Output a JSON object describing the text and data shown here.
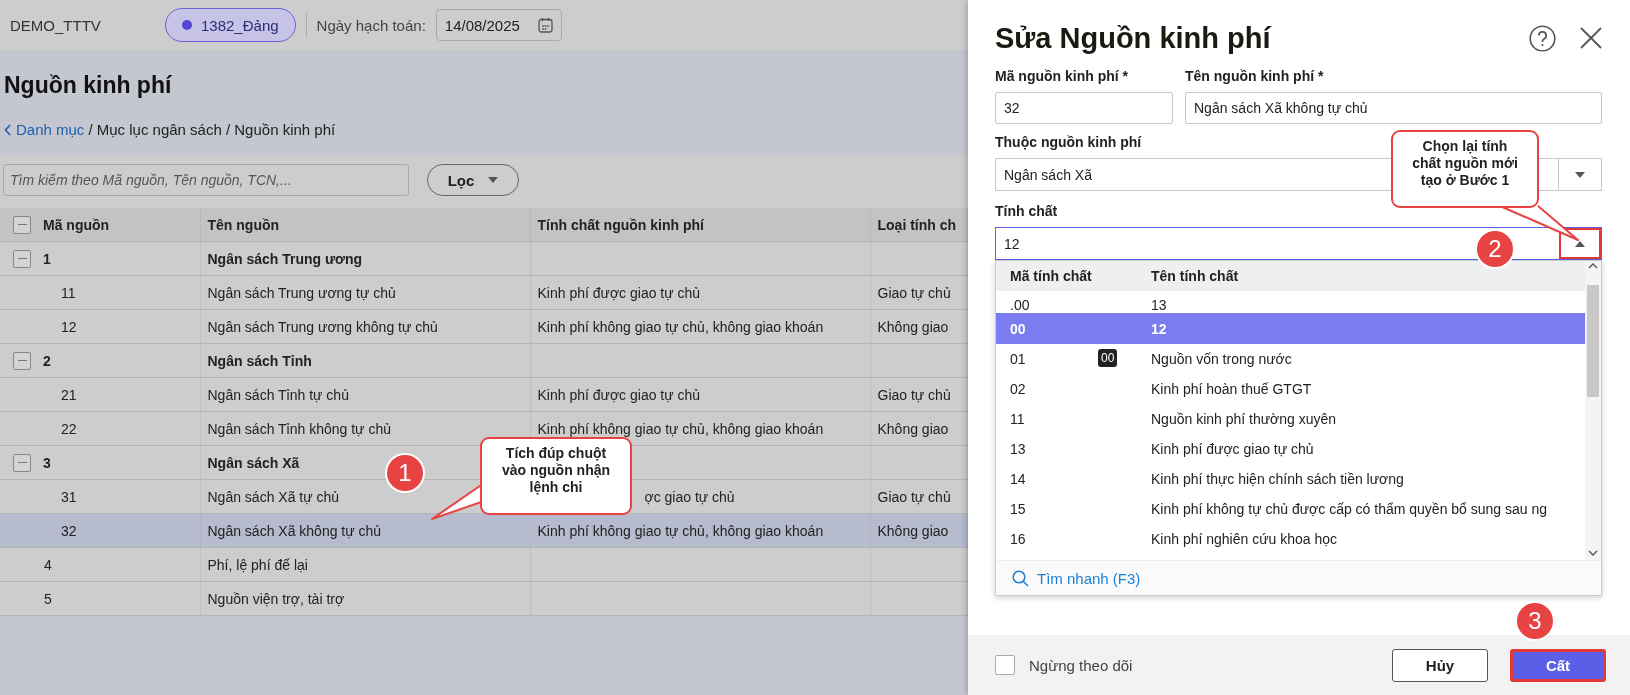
{
  "top_bar": {
    "company": "DEMO_TTTV",
    "user": "1382_Đảng",
    "date_label": "Ngày hạch toán:",
    "date": "14/08/2025"
  },
  "page": {
    "title": "Nguồn kinh phí",
    "breadcrumb_back": "Danh mục",
    "breadcrumb_path": "/ Mục lục ngân sách / Nguồn kinh phí"
  },
  "search": {
    "placeholder": "Tìm kiếm theo Mã nguồn, Tên nguồn, TCN,..."
  },
  "filter_button": "Lọc",
  "table": {
    "columns": [
      "Mã nguồn",
      "Tên nguồn",
      "Tính chất nguồn kinh phí",
      "Loại tính ch"
    ],
    "rows": [
      {
        "kind": "group",
        "expanded": true,
        "selected": false,
        "cells": [
          "1",
          "Ngân sách Trung ương",
          "",
          ""
        ]
      },
      {
        "kind": "child",
        "selected": false,
        "cells": [
          "11",
          "Ngân sách Trung ương tự chủ",
          "Kinh phí được giao tự chủ",
          "Giao tự chủ"
        ]
      },
      {
        "kind": "child",
        "selected": false,
        "cells": [
          "12",
          "Ngân sách Trung ương không tự chủ",
          "Kinh phí không giao tự chủ, không giao khoán",
          "Không giao"
        ]
      },
      {
        "kind": "group",
        "expanded": true,
        "selected": false,
        "cells": [
          "2",
          "Ngân sách Tỉnh",
          "",
          ""
        ]
      },
      {
        "kind": "child",
        "selected": false,
        "cells": [
          "21",
          "Ngân sách Tỉnh tự chủ",
          "Kinh phí được giao tự chủ",
          "Giao tự chủ"
        ]
      },
      {
        "kind": "child",
        "selected": false,
        "cells": [
          "22",
          "Ngân sách Tỉnh không tự chủ",
          "Kinh phí không giao tự chủ, không giao khoán",
          "Không giao"
        ]
      },
      {
        "kind": "group",
        "expanded": true,
        "selected": false,
        "cells": [
          "3",
          "Ngân sách Xã",
          "",
          ""
        ]
      },
      {
        "kind": "child",
        "selected": false,
        "partly_covered": true,
        "cells": [
          "31",
          "Ngân sách Xã tự chủ",
          "ợc giao tự chủ",
          "Giao tự chủ"
        ]
      },
      {
        "kind": "child",
        "selected": true,
        "cells": [
          "32",
          "Ngân sách Xã không tự chủ",
          "Kinh phí không giao tự chủ, không giao khoán",
          "Không giao"
        ]
      },
      {
        "kind": "plain",
        "selected": false,
        "cells": [
          "4",
          "Phí, lệ phí để lại",
          "",
          ""
        ]
      },
      {
        "kind": "plain",
        "selected": false,
        "cells": [
          "5",
          "Nguồn viện trợ, tài trợ",
          "",
          ""
        ]
      }
    ]
  },
  "drawer": {
    "title": "Sửa Nguồn kinh phí",
    "code_field": {
      "label": "Mã nguồn kinh phí *",
      "value": "32"
    },
    "name_field": {
      "label": "Tên nguồn kinh phí *",
      "value": "Ngân sách Xã không tự chủ"
    },
    "parent_field": {
      "label": "Thuộc nguồn kinh phí",
      "value": "Ngân sách Xã"
    },
    "property_field": {
      "label": "Tính chất",
      "value": "12",
      "expanded": true
    },
    "dropdown": {
      "columns": [
        "Mã tính chất",
        "Tên tính chất"
      ],
      "rows": [
        {
          "code": ".00",
          "name": "13",
          "selected": false
        },
        {
          "code": "00",
          "name": "12",
          "selected": true
        },
        {
          "code": "01",
          "name": "Nguồn vốn trong nước",
          "selected": false,
          "tooltip": "00"
        },
        {
          "code": "02",
          "name": "Kinh phí hoàn thuế GTGT",
          "selected": false
        },
        {
          "code": "11",
          "name": "Nguồn kinh phí thường xuyên",
          "selected": false
        },
        {
          "code": "13",
          "name": "Kinh phí được giao tự chủ",
          "selected": false
        },
        {
          "code": "14",
          "name": "Kinh phí thực hiện chính sách tiền lương",
          "selected": false
        },
        {
          "code": "15",
          "name": "Kinh phí không tự chủ được cấp có thẩm quyền bổ sung sau ng",
          "selected": false
        },
        {
          "code": "16",
          "name": "Kinh phí nghiên cứu khoa học",
          "selected": false
        }
      ],
      "quick_search": "Tìm nhanh (F3)"
    },
    "inactive_checkbox": {
      "label": "Ngừng theo dõi",
      "checked": false
    },
    "buttons": [
      {
        "label": "Hủy",
        "kind": "secondary"
      },
      {
        "label": "Cất",
        "kind": "primary"
      }
    ]
  },
  "annotations": [
    {
      "number": "1",
      "text": "Tích đúp chuột vào nguồn nhận lệnh chi"
    },
    {
      "number": "2",
      "text": "Chọn lại tính chất nguồn mới tạo ở Bước 1"
    },
    {
      "number": "3"
    }
  ]
}
